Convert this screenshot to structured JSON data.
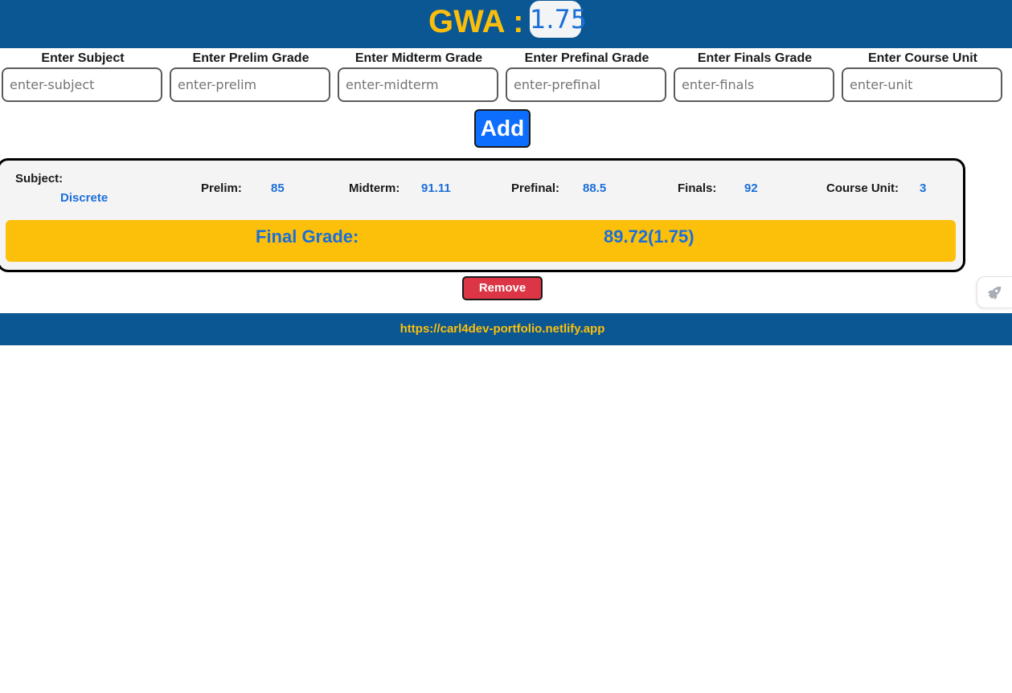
{
  "header": {
    "gwa_label": "GWA :",
    "gwa_value": "1.75"
  },
  "form": {
    "fields": [
      {
        "label": "Enter Subject",
        "placeholder": "enter-subject",
        "value": ""
      },
      {
        "label": "Enter Prelim Grade",
        "placeholder": "enter-prelim",
        "value": ""
      },
      {
        "label": "Enter Midterm Grade",
        "placeholder": "enter-midterm",
        "value": ""
      },
      {
        "label": "Enter Prefinal Grade",
        "placeholder": "enter-prefinal",
        "value": ""
      },
      {
        "label": "Enter Finals Grade",
        "placeholder": "enter-finals",
        "value": ""
      },
      {
        "label": "Enter Course Unit",
        "placeholder": "enter-unit",
        "value": ""
      }
    ],
    "add_label": "Add"
  },
  "record": {
    "subject_label": "Subject:",
    "subject_value": "Discrete",
    "prelim_label": "Prelim:",
    "prelim_value": "85",
    "midterm_label": "Midterm:",
    "midterm_value": "91.11",
    "prefinal_label": "Prefinal:",
    "prefinal_value": "88.5",
    "finals_label": "Finals:",
    "finals_value": "92",
    "unit_label": "Course Unit:",
    "unit_value": "3",
    "final_grade_label": "Final Grade:",
    "final_grade_value": "89.72(1.75)",
    "remove_label": "Remove"
  },
  "footer": {
    "link_text": "https://carl4dev-portfolio.netlify.app"
  },
  "side_widget": {
    "icon": "rocket-icon"
  },
  "colors": {
    "header_bg": "#0b5794",
    "accent_yellow": "#fbbf0b",
    "accent_blue": "#1b6fd9",
    "add_button": "#0d6efd",
    "remove_button": "#dc3545"
  }
}
